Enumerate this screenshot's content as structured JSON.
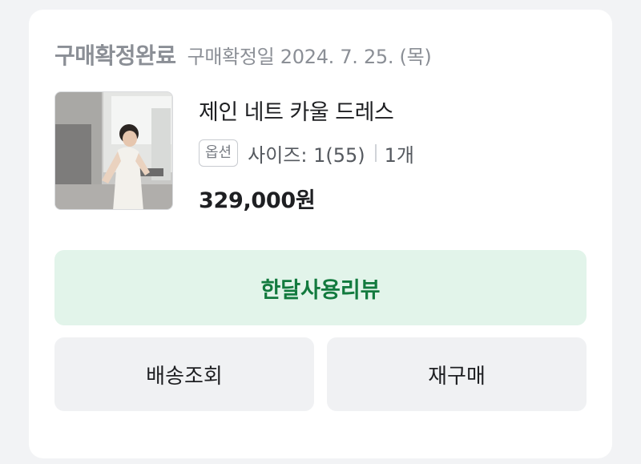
{
  "order": {
    "status": "구매확정완료",
    "confirmed_date": "구매확정일 2024. 7. 25. (목)"
  },
  "product": {
    "name": "제인 네트 카울 드레스",
    "option_badge": "옵션",
    "option_text": "사이즈: 1(55)",
    "quantity": "1개",
    "price": "329,000원"
  },
  "actions": {
    "review_label": "한달사용리뷰",
    "shipping_label": "배송조회",
    "reorder_label": "재구매"
  },
  "colors": {
    "review_bg": "#e2f4ea",
    "review_text": "#127a3e",
    "gray_button_bg": "#f0f1f3"
  }
}
